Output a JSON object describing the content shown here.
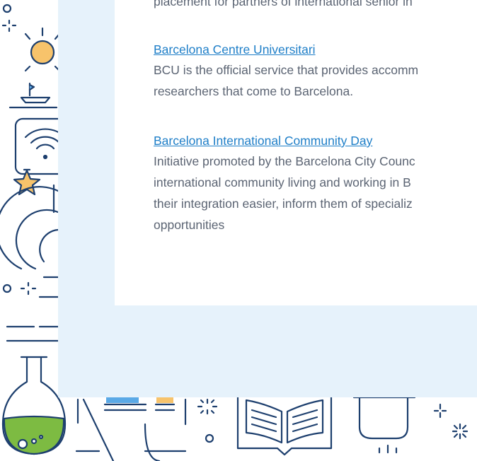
{
  "intro_tail": "placement for partners of international senior in",
  "entries": [
    {
      "link": "Barcelona Centre Universitari",
      "lines": [
        "BCU is the official service that provides accomm",
        "researchers that come to Barcelona."
      ]
    },
    {
      "link": "Barcelona International Community Day",
      "lines": [
        "Initiative promoted by the Barcelona City Counc",
        "international community living and working in B",
        "their integration easier, inform them of specializ",
        "opportunities"
      ]
    }
  ],
  "colors": {
    "panel": "#e6f2fb",
    "link": "#1f7fc8",
    "body_text": "#5b6473",
    "line_art": "#1d3f6e",
    "sun": "#f7c36b",
    "flask_liquid": "#7dbb42",
    "accent_blue": "#5aa9e6"
  },
  "decorations": [
    "sparkle-icon",
    "sun-icon",
    "boat-icon",
    "wifi-router-icon",
    "star-icon",
    "microscope-icon",
    "flask-icon",
    "laptop-icon",
    "open-book-icon",
    "cooking-pot-icon"
  ]
}
